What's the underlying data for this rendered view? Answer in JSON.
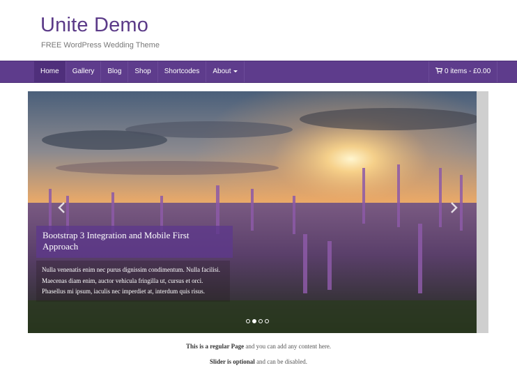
{
  "site": {
    "title": "Unite Demo",
    "description": "FREE WordPress Wedding Theme"
  },
  "nav": {
    "items": [
      {
        "label": "Home",
        "active": true
      },
      {
        "label": "Gallery"
      },
      {
        "label": "Blog"
      },
      {
        "label": "Shop"
      },
      {
        "label": "Shortcodes"
      },
      {
        "label": "About"
      }
    ],
    "cart_label": "0 items - £0.00",
    "cart_icon": "cart-icon"
  },
  "slider": {
    "caption_title": "Bootstrap 3 Integration and Mobile First Approach",
    "caption_text": "Nulla venenatis enim nec purus dignissim condimentum. Nulla facilisi. Maecenas diam enim, auctor vehicula fringilla ut, cursus et orci. Phasellus mi ipsum, iaculis nec imperdiet at, interdum quis risus.",
    "prev_icon": "chevron-left-icon",
    "next_icon": "chevron-right-icon",
    "active_slide": 2,
    "slide_count": 4
  },
  "content": {
    "line1_bold": "This is a regular Page",
    "line1_rest": " and you can add any content here.",
    "line2_bold": "Slider is optional",
    "line2_rest": " and can be disabled."
  },
  "colors": {
    "brand": "#5e3c8c",
    "title": "#5b3a88"
  }
}
